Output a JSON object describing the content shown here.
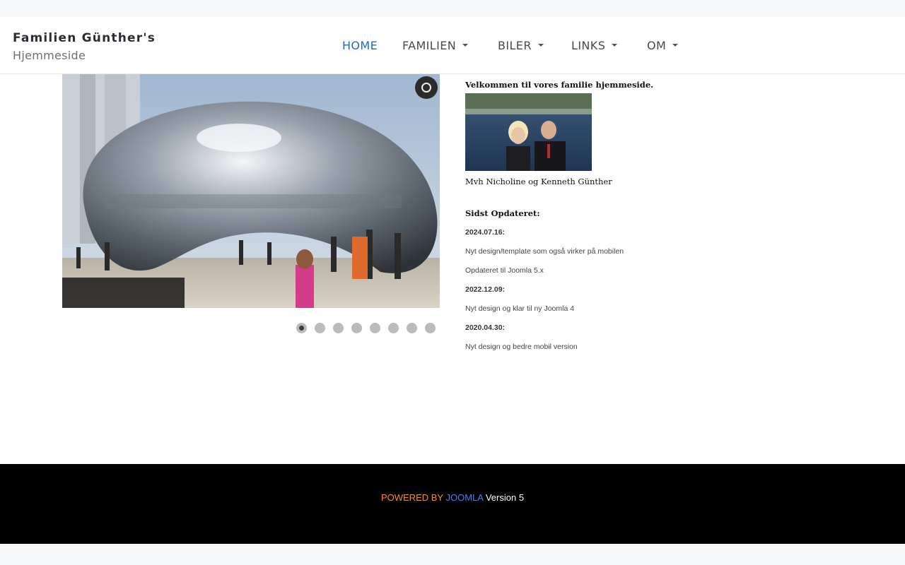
{
  "site": {
    "title": "Familien Günther's",
    "subtitle": "Hjemmeside"
  },
  "nav": {
    "items": [
      {
        "label": "HOME",
        "active": true,
        "dropdown": false
      },
      {
        "label": "FAMILIEN",
        "active": false,
        "dropdown": true
      },
      {
        "label": "BILER",
        "active": false,
        "dropdown": true
      },
      {
        "label": "LINKS",
        "active": false,
        "dropdown": true
      },
      {
        "label": "OM",
        "active": false,
        "dropdown": true
      }
    ]
  },
  "slider": {
    "slide_count": 8,
    "active_index": 0
  },
  "content": {
    "welcome": "Velkommen til vores familie hjemmeside.",
    "regards": "Mvh Nicholine og Kenneth Günther",
    "updates_title": "Sidst Opdateret:",
    "updates": [
      {
        "text": "2024.07.16:",
        "date": true
      },
      {
        "text": "Nyt design/template som også virker på mobilen",
        "date": false
      },
      {
        "text": "Opdateret til Joomla 5.x",
        "date": false
      },
      {
        "text": "2022.12.09:",
        "date": true
      },
      {
        "text": "Nyt design og klar til ny Joomla 4",
        "date": false
      },
      {
        "text": "2020.04.30:",
        "date": true
      },
      {
        "text": "Nyt design og bedre mobil version",
        "date": false
      }
    ]
  },
  "footer": {
    "powered": "POWERED BY",
    "joomla": "JOOMLA",
    "version": "Version 5"
  },
  "colors": {
    "nav_active": "#1b6bc7",
    "footer_powered": "#f0912a",
    "footer_joomla": "#4a80e8"
  }
}
